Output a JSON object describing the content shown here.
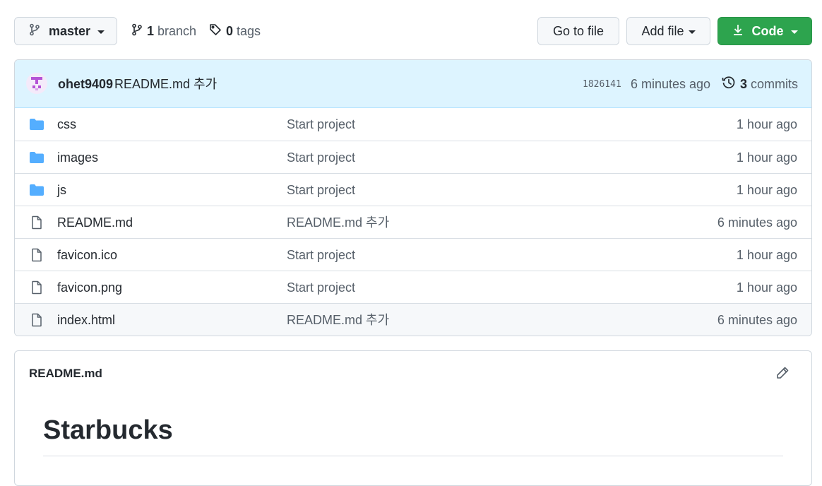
{
  "toolbar": {
    "branch_label": "master",
    "branch_count": "1",
    "branch_word": "branch",
    "tag_count": "0",
    "tag_word": "tags",
    "go_to_file_label": "Go to file",
    "add_file_label": "Add file",
    "code_label": "Code"
  },
  "latest_commit": {
    "author": "ohet9409",
    "message": "README.md 추가",
    "sha": "1826141",
    "time": "6 minutes ago",
    "commit_count": "3",
    "commit_word": "commits"
  },
  "files": [
    {
      "type": "folder",
      "name": "css",
      "message": "Start project",
      "time": "1 hour ago"
    },
    {
      "type": "folder",
      "name": "images",
      "message": "Start project",
      "time": "1 hour ago"
    },
    {
      "type": "folder",
      "name": "js",
      "message": "Start project",
      "time": "1 hour ago"
    },
    {
      "type": "file",
      "name": "README.md",
      "message": "README.md 추가",
      "time": "6 minutes ago"
    },
    {
      "type": "file",
      "name": "favicon.ico",
      "message": "Start project",
      "time": "1 hour ago"
    },
    {
      "type": "file",
      "name": "favicon.png",
      "message": "Start project",
      "time": "1 hour ago"
    },
    {
      "type": "file",
      "name": "index.html",
      "message": "README.md 추가",
      "time": "6 minutes ago"
    }
  ],
  "readme": {
    "filename": "README.md",
    "heading": "Starbucks"
  },
  "colors": {
    "accent_green": "#2da44e",
    "folder_blue": "#54aeff",
    "commit_bar_bg": "#ddf4ff"
  },
  "icons": [
    "git-branch-icon",
    "tag-icon",
    "download-icon",
    "history-icon",
    "folder-icon",
    "file-icon",
    "pencil-icon"
  ]
}
